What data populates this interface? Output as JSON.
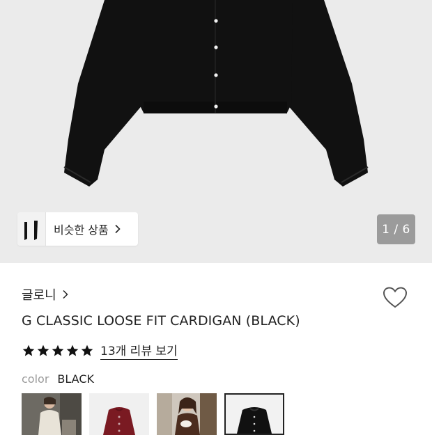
{
  "gallery": {
    "similar_label": "비슷한 상품",
    "page_indicator": "1 / 6",
    "background_color": "#ebebeb",
    "garment_color": "#111111",
    "icons": [
      "chevron-right-icon"
    ]
  },
  "product": {
    "brand": "글로니",
    "name": "G CLASSIC LOOSE FIT CARDIGAN (BLACK)",
    "rating_stars": 5,
    "rating_max": 5,
    "review_link": "13개 리뷰 보기",
    "color_label": "color",
    "color_value": "BLACK",
    "swatches": [
      {
        "name": "model-ivory",
        "selected": false
      },
      {
        "name": "burgundy",
        "selected": false
      },
      {
        "name": "model-brown",
        "selected": false
      },
      {
        "name": "black",
        "selected": true
      }
    ],
    "icons": [
      "heart-icon",
      "star-icon",
      "chevron-right-icon"
    ]
  },
  "colors": {
    "text": "#222222",
    "muted": "#9a9a9a",
    "indicator_bg": "#9b9b9b",
    "burgundy": "#7a1a22"
  }
}
